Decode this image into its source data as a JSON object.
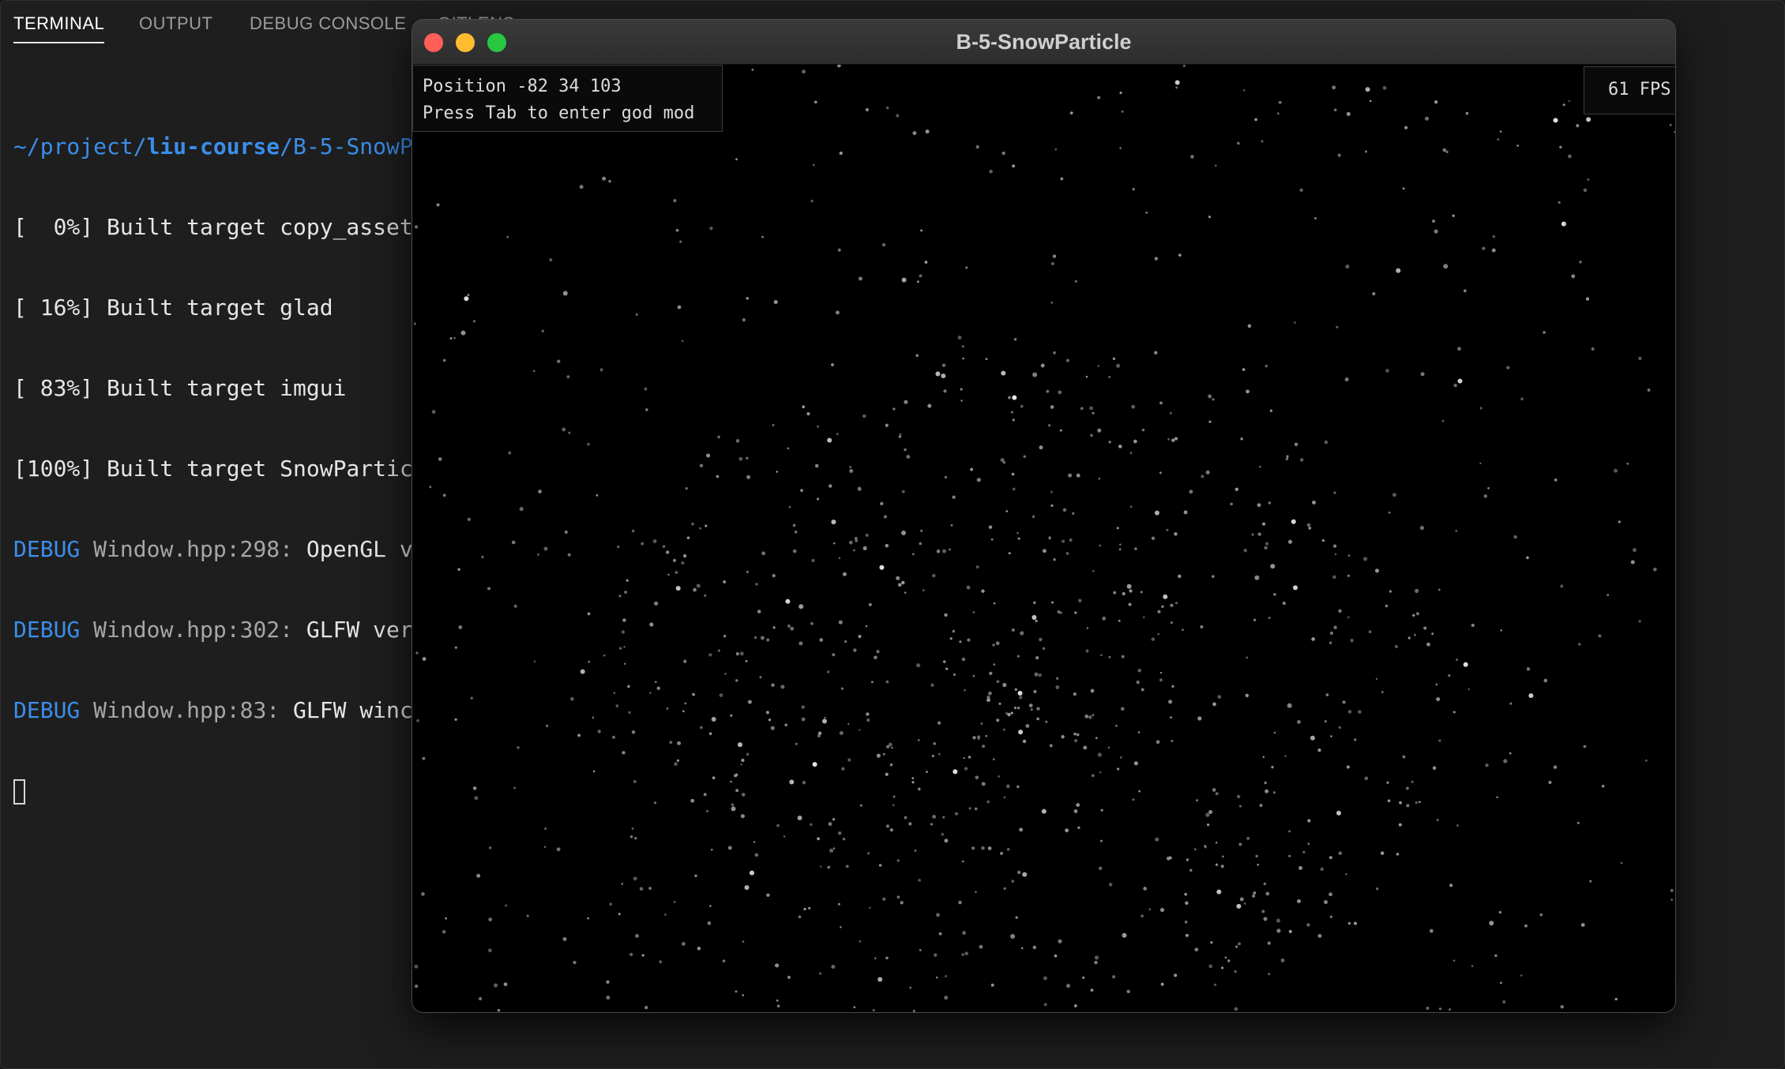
{
  "panel": {
    "tabs": [
      {
        "label": "TERMINAL",
        "active": true
      },
      {
        "label": "OUTPUT"
      },
      {
        "label": "DEBUG CONSOLE"
      },
      {
        "label": "GITLENS"
      }
    ]
  },
  "terminal": {
    "prompt": {
      "p1": "~/project/",
      "p2": "liu-course",
      "p3": "/B-5-SnowP"
    },
    "build_lines": [
      "[  0%] Built target copy_asset",
      "[ 16%] Built target glad",
      "[ 83%] Built target imgui",
      "[100%] Built target SnowPartic"
    ],
    "debug_lines": [
      {
        "tag": "DEBUG",
        "src": "Window.hpp:298:",
        "msg": " OpenGL v"
      },
      {
        "tag": "DEBUG",
        "src": "Window.hpp:302:",
        "msg": " GLFW ver"
      },
      {
        "tag": "DEBUG",
        "src": "Window.hpp:83:",
        "msg": " GLFW winc"
      }
    ]
  },
  "app_window": {
    "title": "B-5-SnowParticle",
    "hud_position": "Position -82 34 103",
    "hud_hint": "Press Tab to enter god mod",
    "fps": "61 FPS",
    "colors": {
      "close": "#ff5f57",
      "minimize": "#febc2e",
      "maximize": "#28c840"
    }
  }
}
